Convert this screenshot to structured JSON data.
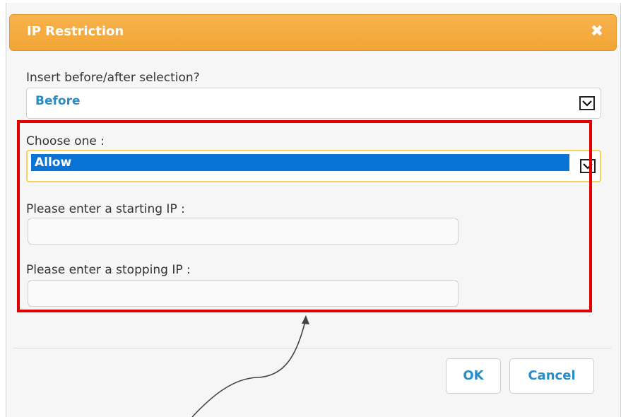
{
  "dialog": {
    "title": "IP Restriction",
    "close_symbol": "✖"
  },
  "insert": {
    "label": "Insert before/after selection?",
    "selected": "Before"
  },
  "choose": {
    "label": "Choose one :",
    "selected": "Allow"
  },
  "start_ip": {
    "label": "Please enter a starting IP :",
    "value": "",
    "placeholder": ""
  },
  "stop_ip": {
    "label": "Please enter a stopping IP :",
    "value": "",
    "placeholder": ""
  },
  "buttons": {
    "ok": "OK",
    "cancel": "Cancel"
  },
  "icons": {
    "close": "close-icon",
    "dropdown": "chevron-down-icon"
  },
  "colors": {
    "titlebar": "#f2a536",
    "selection_highlight": "#0a74d6",
    "link_text": "#2a8cc6",
    "annotation_frame": "#e00000"
  }
}
